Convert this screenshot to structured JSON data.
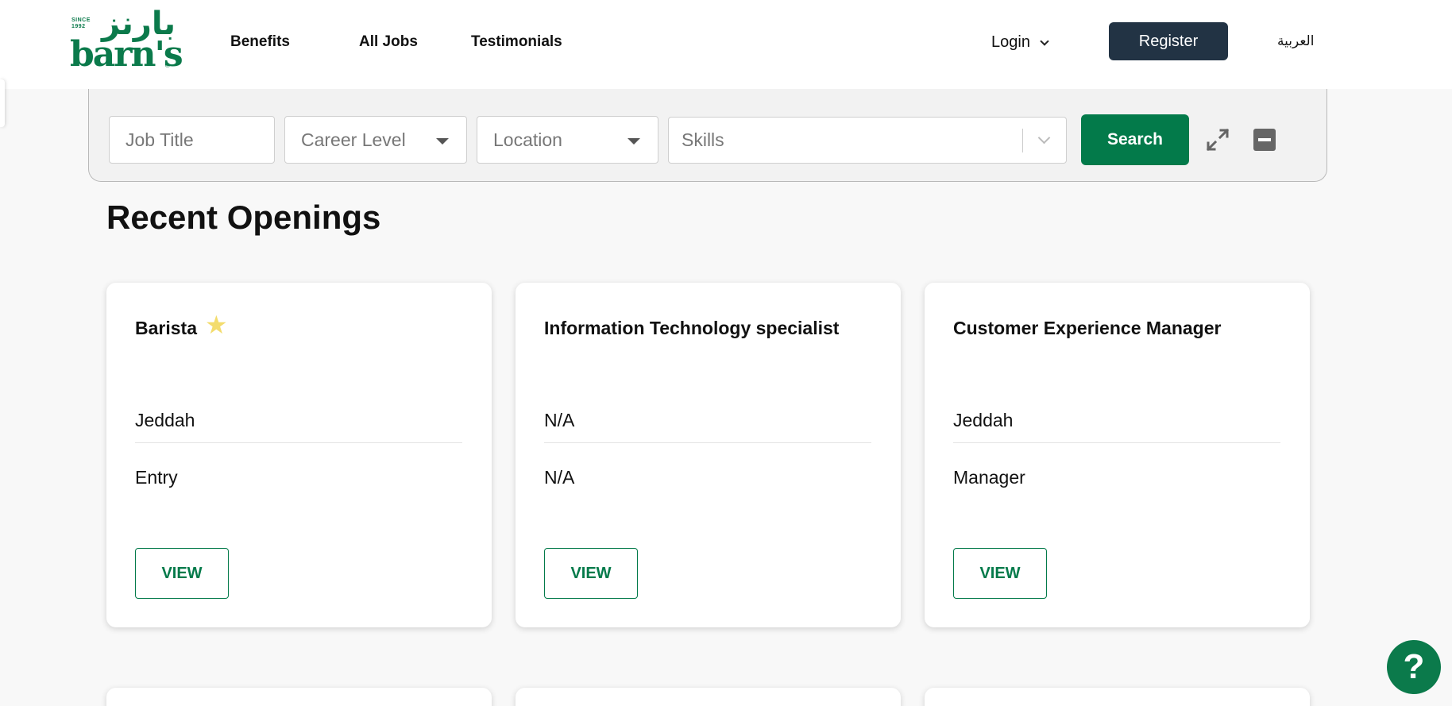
{
  "brand": {
    "since_line1": "SINCE",
    "since_line2": "1992",
    "arabic_name": "بارنز",
    "latin_name": "barn's",
    "registered": "®",
    "color": "#0b7a4b"
  },
  "nav": {
    "links": [
      "Benefits",
      "All Jobs",
      "Testimonials"
    ],
    "login_label": "Login",
    "register_label": "Register",
    "language_label": "العربية"
  },
  "search": {
    "job_title_placeholder": "Job Title",
    "career_level_placeholder": "Career Level",
    "location_placeholder": "Location",
    "skills_placeholder": "Skills",
    "search_label": "Search"
  },
  "section": {
    "title": "Recent Openings"
  },
  "jobs": [
    {
      "title": "Barista",
      "featured": true,
      "location": "Jeddah",
      "level": "Entry",
      "action": "VIEW"
    },
    {
      "title": "Information Technology specialist",
      "featured": false,
      "location": "N/A",
      "level": "N/A",
      "action": "VIEW"
    },
    {
      "title": "Customer Experience Manager",
      "featured": false,
      "location": "Jeddah",
      "level": "Manager",
      "action": "VIEW"
    }
  ],
  "help": {
    "label": "?"
  },
  "colors": {
    "primary_green": "#037a4a",
    "register_bg": "#223344",
    "star": "#f3dc6d"
  }
}
